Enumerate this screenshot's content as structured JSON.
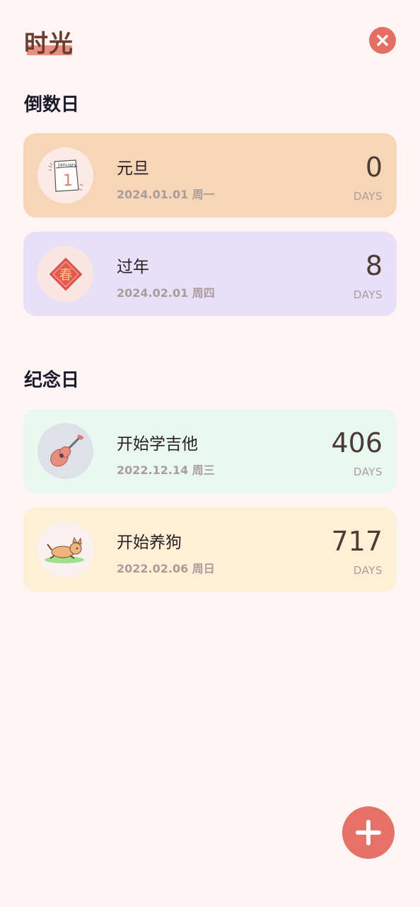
{
  "header": {
    "title": "时光"
  },
  "countdown": {
    "title": "倒数日",
    "items": [
      {
        "name": "元旦",
        "date": "2024.01.01 周一",
        "count": "0",
        "unit": "DAYS",
        "icon": "calendar-january-icon",
        "bg": "#f7d6b8"
      },
      {
        "name": "过年",
        "date": "2024.02.01 周四",
        "count": "8",
        "unit": "DAYS",
        "icon": "spring-festival-icon",
        "bg": "#e8e0f7"
      }
    ]
  },
  "anniversary": {
    "title": "纪念日",
    "items": [
      {
        "name": "开始学吉他",
        "date": "2022.12.14 周三",
        "count": "406",
        "unit": "DAYS",
        "icon": "guitar-icon",
        "bg": "#eaf8f2"
      },
      {
        "name": "开始养狗",
        "date": "2022.02.06 周日",
        "count": "717",
        "unit": "DAYS",
        "icon": "dog-icon",
        "bg": "#fdf0d6"
      }
    ]
  },
  "calendar_icon_text": {
    "month": "January",
    "day": "1"
  },
  "spring_icon_text": "春"
}
